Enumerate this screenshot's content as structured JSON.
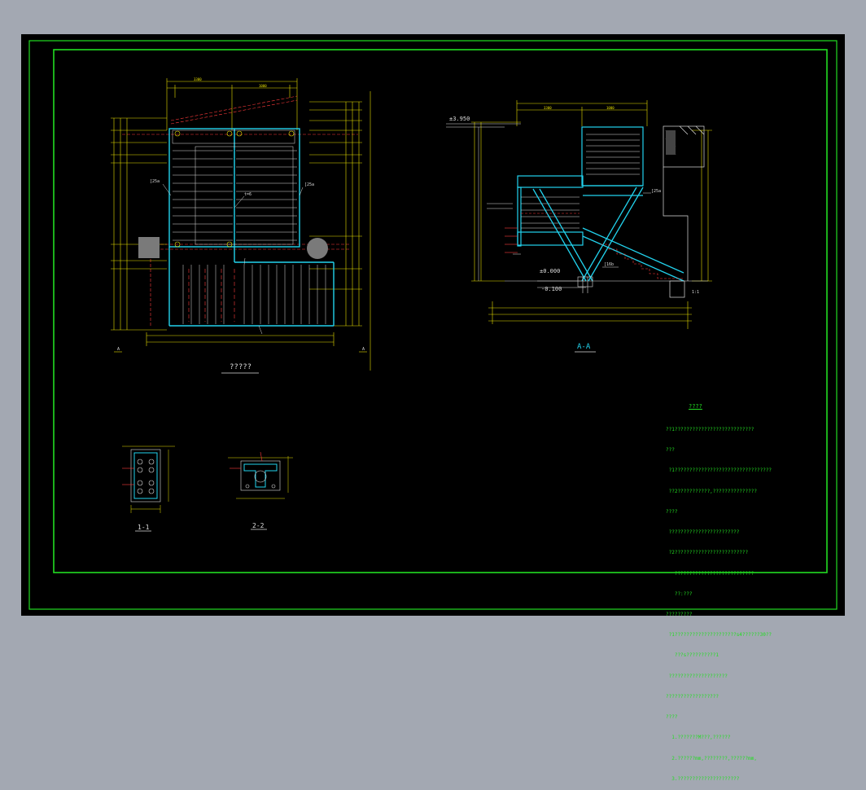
{
  "views": {
    "plan_title": "?????",
    "section_title": "A-A",
    "detail1_title": "1-1",
    "detail2_title": "2-2"
  },
  "plan": {
    "dims_top": [
      "3300",
      "1000",
      "400"
    ],
    "callout_t6": "t=6",
    "callout_l25a": "[25a",
    "callout_l25b": "[25a",
    "markers": [
      "A",
      "A"
    ]
  },
  "section": {
    "elev_top": "±3.950",
    "elev_zero": "±0.000",
    "elev_minus": "-0.100",
    "dims_top": [
      "3300",
      "1000",
      "400"
    ],
    "beam_labels": [
      "[25a",
      "[16b"
    ],
    "label_scale": "1:1"
  },
  "notes": {
    "title": "????",
    "lines": [
      "??1???????????????????????????",
      "???",
      " ?1?????????????????????????????????",
      " ??2???????????,???????????????",
      "????",
      " ????????????????????????",
      " ?2?????????????????????????",
      "   ???????????????????????????",
      "   ??:???",
      "?????????",
      " ?1?????????????????????s4??????30??",
      "   ???s??????????1",
      " ????????????????????",
      "??????????????????",
      "????",
      "  1.???????M???,??????",
      "  2.??????mm,????????,??????mm,",
      "  3.?????????????????????"
    ]
  }
}
